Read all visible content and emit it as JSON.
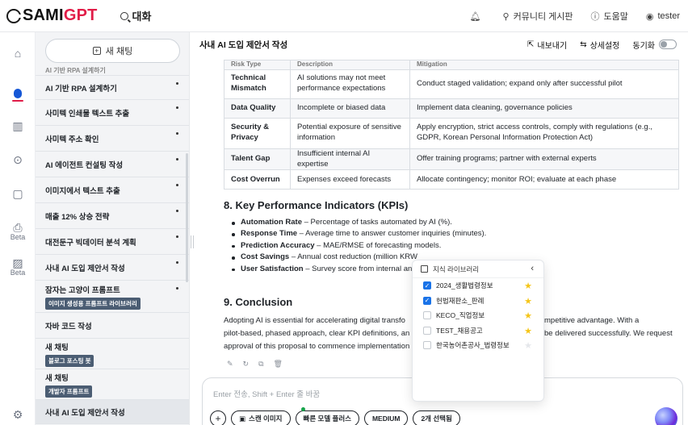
{
  "app": {
    "logo_sami": "SAMI",
    "logo_gpt": "GPT",
    "section": "대화"
  },
  "topbar": {
    "community": "커뮤니티 게시판",
    "help": "도움말",
    "user": "tester"
  },
  "rail": {
    "beta1": "Beta",
    "beta2": "Beta"
  },
  "sidebar": {
    "new_chat": "새 채팅",
    "items": [
      {
        "label": "AI 기반 RPA 설계하기",
        "tag": ""
      },
      {
        "label": "사미텍 인쇄물 텍스트 추출",
        "tag": ""
      },
      {
        "label": "사미텍 주소 확인",
        "tag": ""
      },
      {
        "label": "AI 에이전트 컨설팅 작성",
        "tag": ""
      },
      {
        "label": "이미지에서 텍스트 추출",
        "tag": ""
      },
      {
        "label": "매출 12% 상승 전략",
        "tag": ""
      },
      {
        "label": "대전둔구 빅데이터 분석 계획",
        "tag": ""
      },
      {
        "label": "사내 AI 도입 제안서 작성",
        "tag": ""
      },
      {
        "label": "잠자는 고양이 프롬프트",
        "tag": "이미지 생성용 프롬프트 라이브러리"
      },
      {
        "label": "자바 코드 작성",
        "tag": ""
      },
      {
        "label": "새 채팅",
        "tag": "블로그 포스팅 봇"
      },
      {
        "label": "새 채팅",
        "tag": "개발자 프롬프트"
      },
      {
        "label": "사내 AI 도입 제안서 작성",
        "tag": ""
      }
    ]
  },
  "main": {
    "title": "사내 AI 도입 제안서 작성",
    "export": "내보내기",
    "settings": "상세설정",
    "sync": "동기화"
  },
  "risk_table": {
    "header": [
      "Risk Type",
      "Description",
      "Mitigation"
    ],
    "rows": [
      {
        "type": "Technical Mismatch",
        "desc": "AI solutions may not meet performance expectations",
        "mit": "Conduct staged validation; expand only after successful pilot"
      },
      {
        "type": "Data Quality",
        "desc": "Incomplete or biased data",
        "mit": "Implement data cleaning, governance policies"
      },
      {
        "type": "Security & Privacy",
        "desc": "Potential exposure of sensitive information",
        "mit": "Apply encryption, strict access controls, comply with regulations (e.g., GDPR, Korean Personal Information Protection Act)"
      },
      {
        "type": "Talent Gap",
        "desc": "Insufficient internal AI expertise",
        "mit": "Offer training programs; partner with external experts"
      },
      {
        "type": "Cost Overrun",
        "desc": "Expenses exceed forecasts",
        "mit": "Allocate contingency; monitor ROI; evaluate at each phase"
      }
    ]
  },
  "kpi": {
    "title": "8. Key Performance Indicators (KPIs)",
    "items": [
      {
        "name": "Automation Rate",
        "text": " – Percentage of tasks automated by AI (%)."
      },
      {
        "name": "Response Time",
        "text": " – Average time to answer customer inquiries (minutes)."
      },
      {
        "name": "Prediction Accuracy",
        "text": " – MAE/RMSE of forecasting models."
      },
      {
        "name": "Cost Savings",
        "text": " – Annual cost reduction (million KRW"
      },
      {
        "name": "User Satisfaction",
        "text": " – Survey score from internal an"
      }
    ]
  },
  "conclusion": {
    "title": "9. Conclusion",
    "line1a": "Adopting AI is essential for accelerating digital transfo",
    "line1b": "mpetitive advantage. With a",
    "line2a": "pilot-based, phased approach, clear KPI definitions, an",
    "line2b": "be delivered successfully. We request",
    "line3": "approval of this proposal to commence implementation"
  },
  "input": {
    "placeholder": "Enter 전송,  Shift + Enter 줄 바꿈",
    "scan": "스캔 이미지",
    "model": "빠른 모델 플러스",
    "level": "MEDIUM",
    "selected": "2개 선택됨"
  },
  "library": {
    "title": "지식 라이브러리",
    "items": [
      {
        "label": "2024_생활법령정보",
        "checked": true,
        "starred": true
      },
      {
        "label": "헌법재판소_판례",
        "checked": true,
        "starred": true
      },
      {
        "label": "KECO_직업정보",
        "checked": false,
        "starred": true
      },
      {
        "label": "TEST_채용공고",
        "checked": false,
        "starred": true
      },
      {
        "label": "한국농어촌공사_법령정보",
        "checked": false,
        "starred": false
      }
    ]
  },
  "icons": {
    "bell": "bell-icon",
    "community": "community-icon",
    "help": "help-icon",
    "user": "user-icon",
    "home": "home-icon",
    "chat": "chat-icon",
    "library": "library-icon",
    "play": "play-icon",
    "note": "note-icon",
    "settings": "gear-icon"
  },
  "colors": {
    "brand": "#e11d48",
    "accent": "#1a73e8",
    "tag_bg": "#4b5d73",
    "star": "#f5c518"
  }
}
